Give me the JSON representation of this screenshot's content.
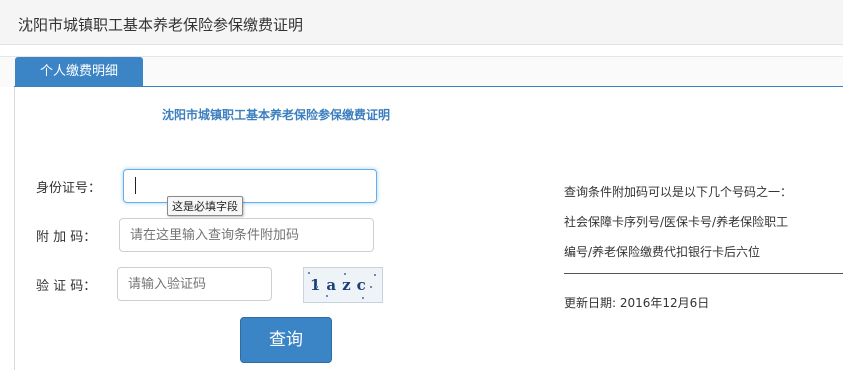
{
  "header": {
    "title": "沈阳市城镇职工基本养老保险参保缴费证明"
  },
  "tabs": [
    {
      "label": "个人缴费明细",
      "active": true
    }
  ],
  "form": {
    "title": "沈阳市城镇职工基本养老保险参保缴费证明",
    "id_label": "身份证号：",
    "id_value": "",
    "id_tooltip": "这是必填字段",
    "extra_label": "附 加 码：",
    "extra_placeholder": "请在这里输入查询条件附加码",
    "captcha_label": "验 证 码：",
    "captcha_placeholder": "请输入验证码",
    "captcha_text": "1azc",
    "query_button": "查询"
  },
  "info": {
    "line1": "查询条件附加码可以是以下几个号码之一：",
    "line2": "社会保障卡序列号/医保卡号/养老保险职工",
    "line3": "编号/养老保险缴费代扣银行卡后六位",
    "updated": "更新日期: 2016年12月6日"
  },
  "colors": {
    "accent": "#3b84c5",
    "title_blue": "#3c7fbf"
  }
}
